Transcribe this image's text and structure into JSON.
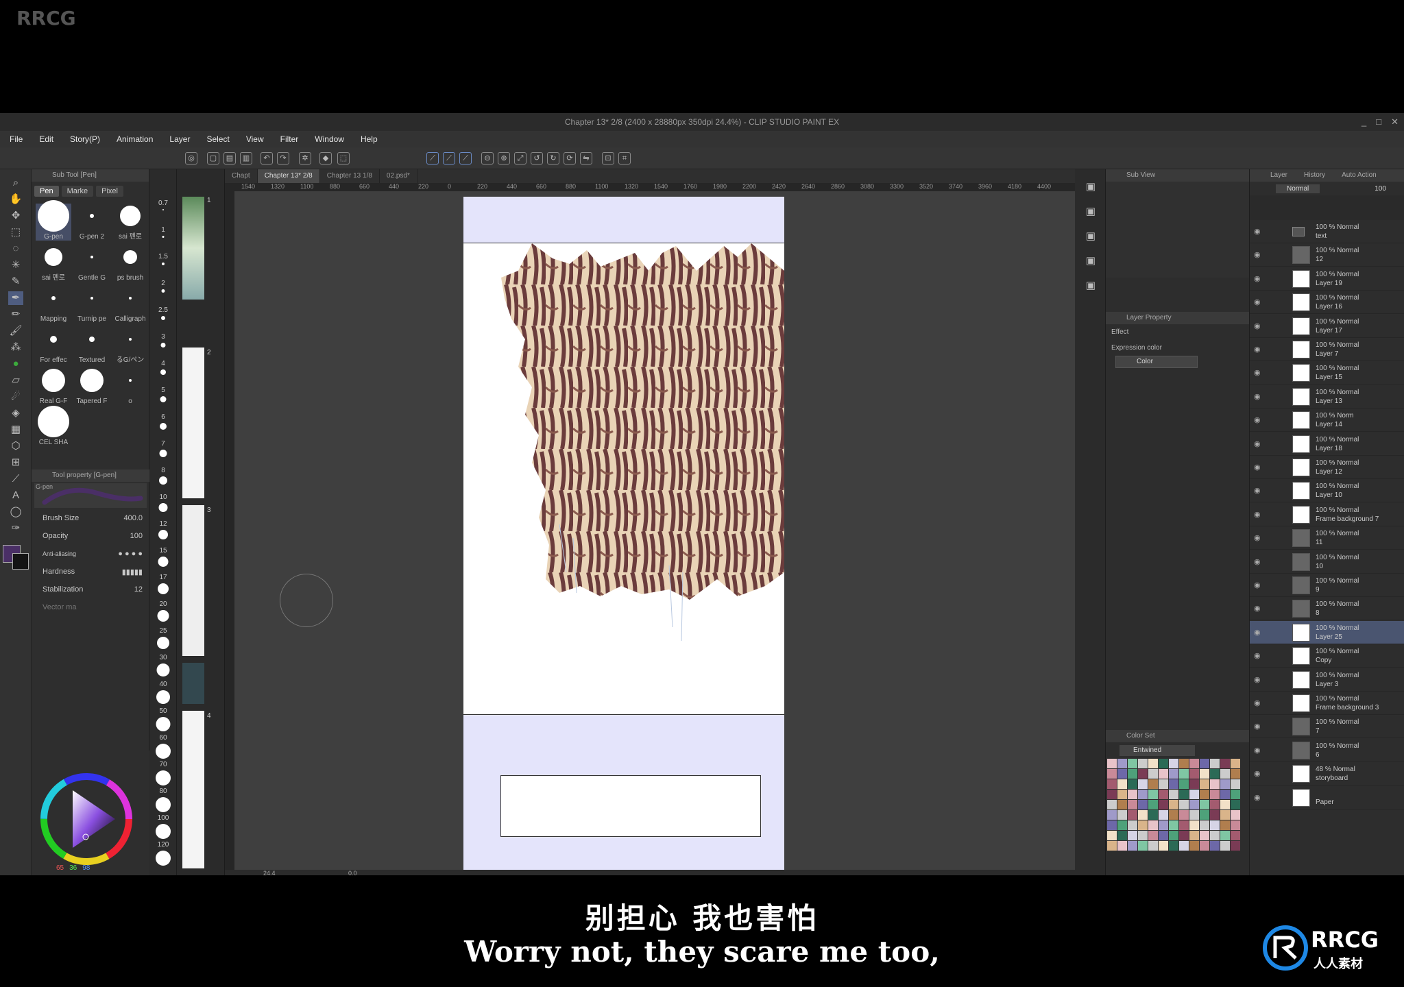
{
  "watermark_corner": "RRCG",
  "window": {
    "title": "Chapter 13* 2/8 (2400 x 28880px 350dpi 24.4%)  - CLIP STUDIO PAINT EX",
    "min": "_",
    "max": "□",
    "close": "✕"
  },
  "menu": [
    "File",
    "Edit",
    "Story(P)",
    "Animation",
    "Layer",
    "Select",
    "View",
    "Filter",
    "Window",
    "Help"
  ],
  "subtool": {
    "header": "Sub Tool [Pen]",
    "tabs": [
      "Pen",
      "Marke",
      "Pixel"
    ],
    "brushes": [
      {
        "label": "G-pen",
        "size": 46,
        "selected": true
      },
      {
        "label": "G-pen 2",
        "size": 6
      },
      {
        "label": "sai 펜로",
        "size": 30
      },
      {
        "label": "sai 펜로",
        "size": 26
      },
      {
        "label": "Gentle G",
        "size": 4
      },
      {
        "label": "ps brush",
        "size": 20
      },
      {
        "label": "Mapping",
        "size": 6
      },
      {
        "label": "Turnip pe",
        "size": 4
      },
      {
        "label": "Calligraph",
        "size": 4
      },
      {
        "label": "For effec",
        "size": 10
      },
      {
        "label": "Textured",
        "size": 8
      },
      {
        "label": "るG/ペン",
        "size": 4
      },
      {
        "label": "Real G-F",
        "size": 34
      },
      {
        "label": "Tapered F",
        "size": 34
      },
      {
        "label": "o",
        "size": 4
      },
      {
        "label": "CEL SHA",
        "size": 46
      }
    ]
  },
  "tool_property": {
    "header": "Tool property [G-pen]",
    "preview_label": "G-pen",
    "brush_size_label": "Brush Size",
    "brush_size_value": "400.0",
    "opacity_label": "Opacity",
    "opacity_value": "100",
    "antialias_label": "Anti-aliasing",
    "hardness_label": "Hardness",
    "stabilization_label": "Stabilization",
    "stabilization_value": "12",
    "vector_label": "Vector ma"
  },
  "color": {
    "main": "#4a2f66",
    "sub": "#141414",
    "readout": [
      "65",
      "36",
      "98"
    ]
  },
  "zoom_levels": [
    "0.7",
    "1",
    "1.5",
    "2",
    "2.5",
    "3",
    "4",
    "5",
    "6",
    "7",
    "8",
    "10",
    "12",
    "15",
    "17",
    "20",
    "25",
    "30",
    "40",
    "50",
    "60",
    "70",
    "80",
    "100",
    "120"
  ],
  "nav_pages": [
    "1",
    "2",
    "3",
    "4"
  ],
  "doctabs": [
    "Chapt",
    "Chapter 13* 2/8",
    "Chapter 13 1/8",
    "02.psd*"
  ],
  "ruler_ticks": [
    "1540",
    "1320",
    "1100",
    "880",
    "660",
    "440",
    "220",
    "0",
    "220",
    "440",
    "660",
    "880",
    "1100",
    "1320",
    "1540",
    "1760",
    "1980",
    "2200",
    "2420",
    "2640",
    "2860",
    "3080",
    "3300",
    "3520",
    "3740",
    "3960",
    "4180",
    "4400"
  ],
  "status": {
    "zoom": "24.4",
    "angle": "0.0"
  },
  "subview": {
    "header": "Sub View",
    "layer_property": "Layer Property",
    "effect_label": "Effect",
    "expression_label": "Expression color",
    "expression_value": "Color",
    "colorset_header": "Color Set",
    "colorset_name": "Entwined"
  },
  "layers_panel": {
    "header": "Layer",
    "tab2": "History",
    "tab3": "Auto Action",
    "blend": "Normal",
    "opacity": "100",
    "rows": [
      {
        "l1": "100 % Normal",
        "l2": "text",
        "kind": "folder"
      },
      {
        "l1": "100 % Normal",
        "l2": "12",
        "kind": "frame"
      },
      {
        "l1": "100 % Normal",
        "l2": "Layer 19",
        "kind": "layer"
      },
      {
        "l1": "100 % Normal",
        "l2": "Layer 16",
        "kind": "layer"
      },
      {
        "l1": "100 % Normal",
        "l2": "Layer 17",
        "kind": "layer"
      },
      {
        "l1": "100 % Normal",
        "l2": "Layer 7",
        "kind": "layer"
      },
      {
        "l1": "100 % Normal",
        "l2": "Layer 15",
        "kind": "layer"
      },
      {
        "l1": "100 % Normal",
        "l2": "Layer 13",
        "kind": "layer"
      },
      {
        "l1": "100 % Norm",
        "l2": "Layer 14",
        "kind": "layer"
      },
      {
        "l1": "100 % Normal",
        "l2": "Layer 18",
        "kind": "layer"
      },
      {
        "l1": "100 % Normal",
        "l2": "Layer 12",
        "kind": "layer"
      },
      {
        "l1": "100 % Normal",
        "l2": "Layer 10",
        "kind": "layer"
      },
      {
        "l1": "100 % Normal",
        "l2": "Frame background 7",
        "kind": "layer"
      },
      {
        "l1": "100 % Normal",
        "l2": "11",
        "kind": "frame"
      },
      {
        "l1": "100 % Normal",
        "l2": "10",
        "kind": "frame"
      },
      {
        "l1": "100 % Normal",
        "l2": "9",
        "kind": "frame"
      },
      {
        "l1": "100 % Normal",
        "l2": "8",
        "kind": "frame"
      },
      {
        "l1": "100 % Normal",
        "l2": "Layer 25",
        "kind": "layer",
        "selected": true
      },
      {
        "l1": "100 % Normal",
        "l2": "Copy",
        "kind": "layer"
      },
      {
        "l1": "100 % Normal",
        "l2": "Layer 3",
        "kind": "layer"
      },
      {
        "l1": "100 % Normal",
        "l2": "Frame background 3",
        "kind": "layer"
      },
      {
        "l1": "100 % Normal",
        "l2": "7",
        "kind": "frame"
      },
      {
        "l1": "100 % Normal",
        "l2": "6",
        "kind": "frame"
      },
      {
        "l1": "48 % Normal",
        "l2": "storyboard",
        "kind": "layer"
      },
      {
        "l1": "",
        "l2": "Paper",
        "kind": "layer"
      }
    ]
  },
  "subtitles": {
    "cn": "别担心 我也害怕",
    "en": "Worry not, they scare me too,"
  },
  "logo": {
    "big": "RRCG",
    "small": "人人素材"
  }
}
